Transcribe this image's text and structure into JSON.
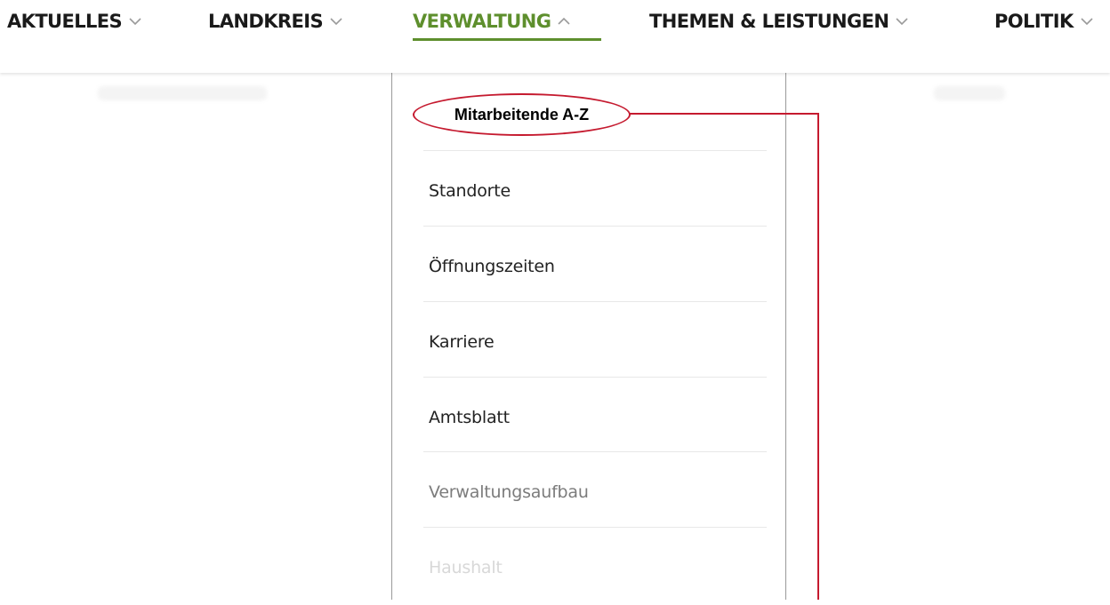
{
  "nav": {
    "items": [
      {
        "label": "AKTUELLES",
        "expanded": false
      },
      {
        "label": "LANDKREIS",
        "expanded": false
      },
      {
        "label": "VERWALTUNG",
        "expanded": true
      },
      {
        "label": "THEMEN & LEISTUNGEN",
        "expanded": false
      },
      {
        "label": "POLITIK",
        "expanded": false
      }
    ]
  },
  "dropdown": {
    "items": [
      {
        "label": "Mitarbeitende A-Z",
        "highlighted": true
      },
      {
        "label": "Standorte"
      },
      {
        "label": "Öffnungszeiten"
      },
      {
        "label": "Karriere"
      },
      {
        "label": "Amtsblatt"
      },
      {
        "label": "Verwaltungsaufbau"
      },
      {
        "label": "Haushalt"
      }
    ]
  },
  "colors": {
    "accent_green": "#5e8f2d",
    "callout_red": "#c51a2f",
    "text_dark": "#1a1a1a"
  },
  "icons": {
    "chevron_down": "chevron-down-icon",
    "chevron_up": "chevron-up-icon"
  }
}
